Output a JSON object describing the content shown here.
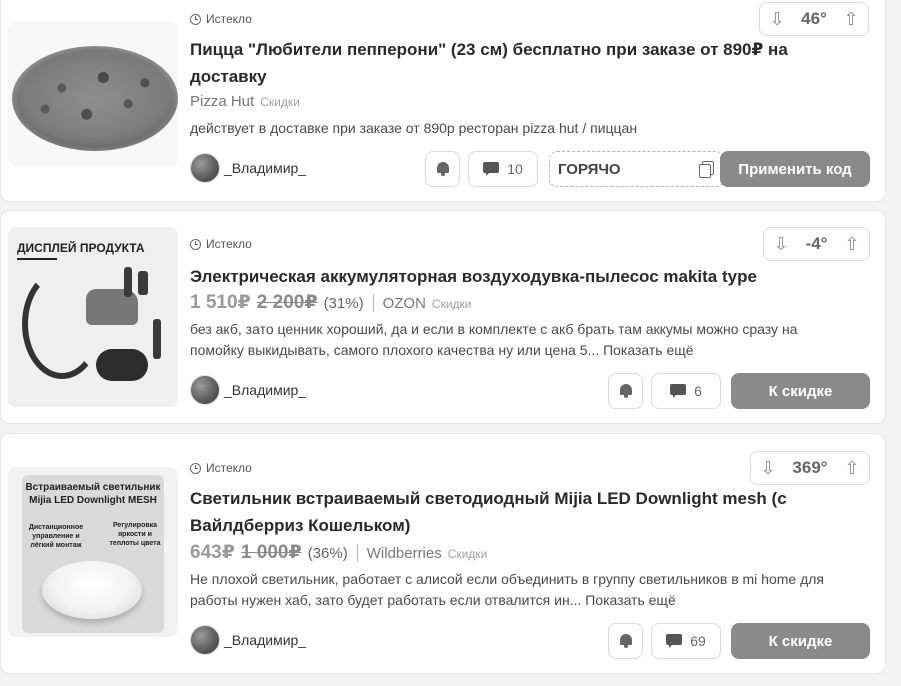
{
  "deals": [
    {
      "status": "Истекло",
      "temperature": "46°",
      "title": "Пицца \"Любители пепперони\" (23 см) бесплатно при заказе от 890₽ на доставку",
      "merchant": "Pizza Hut",
      "tag": "Скидки",
      "description": "действует в доставке при заказе от 890р ресторан pizza hut / пиццан",
      "author": "_Владимир_",
      "comments": "10",
      "code": "ГОРЯЧО",
      "action_label": "Применить код"
    },
    {
      "status": "Истекло",
      "temperature": "-4°",
      "title": "Электрическая аккумуляторная воздуходувка-пылесос makita type",
      "price": "1 510₽",
      "old_price": "2 200₽",
      "discount": "(31%)",
      "merchant": "OZON",
      "tag": "Скидки",
      "description": "без акб, зато ценник хороший, да и если в комплекте с акб брать там аккумы можно сразу на помойку выкидывать, самого плохого качества ну или цена 5... Показать ещё",
      "author": "_Владимир_",
      "comments": "6",
      "action_label": "К скидке",
      "image_label": "ДИСПЛЕЙ ПРОДУКТА"
    },
    {
      "status": "Истекло",
      "temperature": "369°",
      "title": "Светильник встраиваемый светодиодный Mijia LED Downlight mesh (с Вайлдберриз Кошельком)",
      "price": "643₽",
      "old_price": "1 000₽",
      "discount": "(36%)",
      "merchant": "Wildberries",
      "tag": "Скидки",
      "description": "Не плохой светильник, работает с алисой если объединить в группу светильников в mi home для работы нужен хаб, зато будет работать если отвалится ин... Показать ещё",
      "author": "_Владимир_",
      "comments": "69",
      "action_label": "К скидке",
      "image_title": "Встраиваемый светильник Mijia LED Downlight MESH",
      "image_left": "Дистанционное управление и лёгкий монтаж",
      "image_right": "Регулировка яркости и теплоты цвета"
    }
  ],
  "icons": {
    "vote_down": "arrow-down-icon",
    "vote_up": "arrow-up-icon",
    "clock": "clock-icon",
    "bell": "bell-icon",
    "comment": "comment-icon",
    "copy": "copy-icon"
  },
  "colors": {
    "action_button": "#8a8a8a",
    "card_bg": "#ffffff",
    "page_bg": "#f2f2f3"
  }
}
